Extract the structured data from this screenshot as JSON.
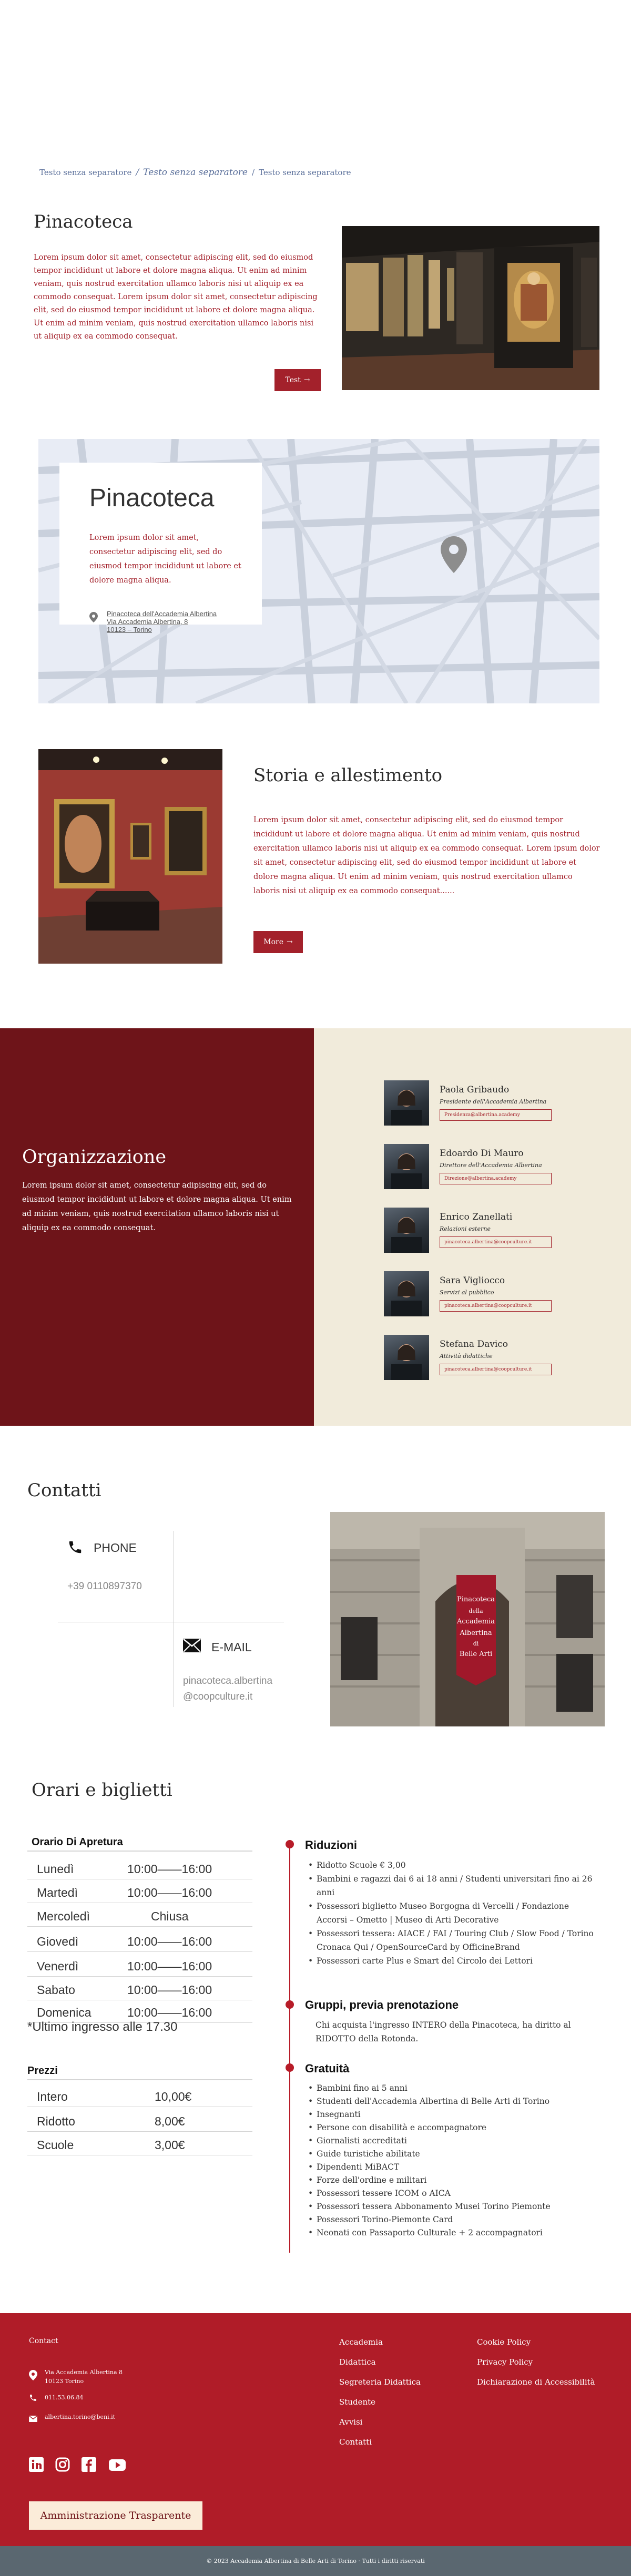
{
  "breadcrumb": [
    "Testo senza separatore",
    "/",
    "Testo senza separatore",
    "/",
    "Testo senza separatore"
  ],
  "intro": {
    "title": "Pinacoteca",
    "text": "Lorem ipsum dolor sit amet, consectetur adipiscing elit, sed do eiusmod tempor incididunt ut labore et dolore magna aliqua. Ut enim ad minim veniam, quis nostrud exercitation ullamco laboris nisi ut aliquip ex ea commodo consequat. Lorem ipsum dolor sit amet, consectetur adipiscing elit, sed do eiusmod tempor incididunt ut labore et dolore magna aliqua. Ut enim ad minim veniam, quis nostrud exercitation ullamco laboris nisi ut aliquip ex ea commodo consequat.",
    "button": "Test",
    "arrow": "→"
  },
  "map": {
    "title": "Pinacoteca",
    "text": "Lorem ipsum dolor sit amet, consectetur adipiscing elit, sed do eiusmod tempor incididunt ut labore et dolore magna aliqua.",
    "address": [
      "Pinacoteca dell'Accademia Albertina",
      "Via Accademia Albertina, 8",
      "10123 – Torino"
    ]
  },
  "storia": {
    "title": "Storia e allestimento",
    "text": "Lorem ipsum dolor sit amet, consectetur adipiscing elit, sed do eiusmod tempor incididunt ut labore et dolore magna aliqua. Ut enim ad minim veniam, quis nostrud exercitation ullamco laboris nisi ut aliquip ex ea commodo consequat. Lorem ipsum dolor sit amet, consectetur adipiscing elit, sed do eiusmod tempor incididunt ut labore et dolore magna aliqua. Ut enim ad minim veniam, quis nostrud exercitation ullamco laboris nisi ut aliquip ex ea commodo consequat......",
    "button": "More",
    "arrow": "→"
  },
  "org": {
    "title": "Organizzazione",
    "text": "Lorem ipsum dolor sit amet, consectetur adipiscing elit, sed do eiusmod tempor incididunt ut labore et dolore magna aliqua. Ut enim ad minim veniam, quis nostrud exercitation ullamco laboris nisi ut aliquip ex ea commodo consequat.",
    "people": [
      {
        "name": "Paola Gribaudo",
        "role": "Presidente dell'Accademia Albertina",
        "email": "Presidenza@albertina.academy"
      },
      {
        "name": "Edoardo Di Mauro",
        "role": "Direttore dell'Accademia Albertina",
        "email": "Direzione@albertina.academy"
      },
      {
        "name": "Enrico Zanellati",
        "role": "Relazioni esterne",
        "email": "pinacoteca.albertina@coopculture.it"
      },
      {
        "name": "Sara Vigliocco",
        "role": "Servizi al pubblico",
        "email": "pinacoteca.albertina@coopculture.it"
      },
      {
        "name": "Stefana Davico",
        "role": "Attività didattiche",
        "email": "pinacoteca.albertina@coopculture.it"
      }
    ]
  },
  "contatti": {
    "title": "Contatti",
    "phone_label": "PHONE",
    "phone_value": "+39 0110897370",
    "email_label": "E-MAIL",
    "email_value": [
      "pinacoteca.albertina",
      "@coopculture.it"
    ],
    "banner": [
      "Pinacoteca",
      "della",
      "Accademia",
      "Albertina",
      "di",
      "Belle Arti"
    ]
  },
  "orari": {
    "title": "Orari e biglietti",
    "hours_heading": "Orario Di Apretura",
    "hours": [
      {
        "day": "Lunedì",
        "time": "10:00——16:00"
      },
      {
        "day": "Martedì",
        "time": "10:00——16:00"
      },
      {
        "day": "Mercoledì",
        "time": "Chiusa"
      },
      {
        "day": "Giovedì",
        "time": "10:00——16:00"
      },
      {
        "day": "Venerdì",
        "time": "10:00——16:00"
      },
      {
        "day": "Sabato",
        "time": "10:00——16:00"
      },
      {
        "day": "Domenica",
        "time": "10:00——16:00"
      }
    ],
    "note": "*Ultimo ingresso alle 17.30",
    "prices_heading": "Prezzi",
    "prices": [
      {
        "label": "Intero",
        "value": "10,00€"
      },
      {
        "label": "Ridotto",
        "value": "8,00€"
      },
      {
        "label": "Scuole",
        "value": "3,00€"
      }
    ],
    "riduzioni_heading": "Riduzioni",
    "riduzioni": [
      "Ridotto Scuole € 3,00",
      "Bambini e ragazzi dai 6 ai 18 anni / Studenti universitari fino ai 26 anni",
      "Possessori biglietto Museo Borgogna di Vercelli / Fondazione Accorsi – Ometto | Museo di Arti Decorative",
      "Possessori tessera: AIACE / FAI / Touring Club / Slow Food / Torino Cronaca Qui / OpenSourceCard by OfficineBrand",
      "Possessori carte Plus e Smart del Circolo dei Lettori"
    ],
    "gruppi_heading": "Gruppi, previa prenotazione",
    "gruppi_text": "Chi acquista l'ingresso INTERO della Pinacoteca, ha diritto al RIDOTTO della Rotonda.",
    "gratuita_heading": "Gratuità",
    "gratuita": [
      "Bambini fino ai 5 anni",
      "Studenti dell'Accademia Albertina di Belle Arti di Torino",
      "Insegnanti",
      "Persone con disabilità e accompagnatore",
      "Giornalisti accreditati",
      "Guide turistiche abilitate",
      "Dipendenti MiBACT",
      "Forze dell'ordine e militari",
      "Possessori tessere ICOM o AICA",
      "Possessori tessera Abbonamento Musei Torino Piemonte",
      "Possessori Torino-Piemonte Card",
      "Neonati con Passaporto Culturale + 2 accompagnatori"
    ]
  },
  "footer": {
    "contact_heading": "Contact",
    "address": [
      "Via Accademia Albertina 8",
      "10123 Torino"
    ],
    "phone": "011.53.06.84",
    "email": "albertina.torino@beni.it",
    "col2": [
      "Accademia",
      "Didattica",
      "Segreteria Didattica",
      "Studente",
      "Avvisi",
      "Contatti"
    ],
    "col3": [
      "Cookie Policy",
      "Privacy Policy",
      "Dichiarazione di Accessibilità"
    ],
    "button": "Amministrazione Trasparente",
    "copyright": "© 2023 Accademia Albertina di Belle Arti di Torino · Tutti i diritti riservati"
  }
}
